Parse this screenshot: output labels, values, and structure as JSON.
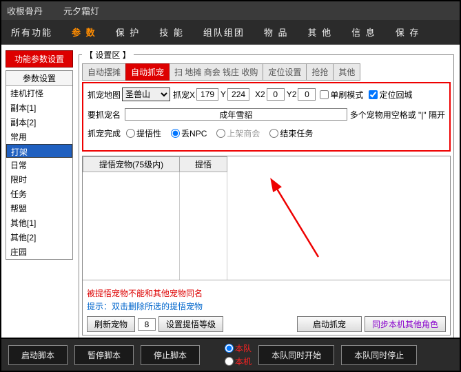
{
  "titlebar": {
    "t1": "收根骨丹",
    "t2": "元夕霜灯"
  },
  "menu": [
    "所有功能",
    "参 数",
    "保 护",
    "技 能",
    "组队组团",
    "物 品",
    "其 他",
    "信 息",
    "保 存"
  ],
  "menu_active": 1,
  "sidebar": {
    "title": "功能参数设置",
    "head": "参数设置",
    "items": [
      "挂机打怪",
      "副本[1]",
      "副本[2]",
      "常用",
      "打架",
      "日常",
      "限时",
      "任务",
      "帮盟",
      "其他[1]",
      "其他[2]",
      "庄园"
    ],
    "selected": 4
  },
  "settings_legend": "【 设置区 】",
  "tabs": [
    "自动摆摊",
    "自动抓宠",
    "扫 地摊 商会 钱庄 收购",
    "定位设置",
    "抢抢",
    "其他"
  ],
  "tab_active": 1,
  "capture": {
    "map_label": "抓宠地图",
    "map_value": "圣兽山",
    "xy_label": "抓宠X",
    "x": "179",
    "y_label": "Y",
    "y": "224",
    "x2_label": "X2",
    "x2": "0",
    "y2_label": "Y2",
    "y2": "0",
    "single_label": "单刷模式",
    "return_label": "定位回城",
    "return_checked": true
  },
  "petname": {
    "label": "要抓宠名",
    "value": "成年雪貂",
    "hint": "多个宠物用空格或 \"|\" 隔开"
  },
  "after": {
    "label": "抓宠完成",
    "opts": [
      "提悟性",
      "丢NPC",
      "上架商会",
      "结束任务"
    ],
    "selected": 1
  },
  "table": {
    "h1": "提悟宠物(75级内)",
    "h2": "提悟"
  },
  "hint1": "被提悟宠物不能和其他宠物同名",
  "hint2": "提示：双击删除所选的提悟宠物",
  "bottom": {
    "refresh": "刷新宠物",
    "num": "8",
    "setlv": "设置提悟等级",
    "start": "启动抓宠",
    "sync": "同步本机其他角色"
  },
  "footer": {
    "start": "启动脚本",
    "pause": "暂停脚本",
    "stop": "停止脚本",
    "radio1": "本队",
    "radio2": "本机",
    "startall": "本队同时开始",
    "stopall": "本队同时停止"
  }
}
